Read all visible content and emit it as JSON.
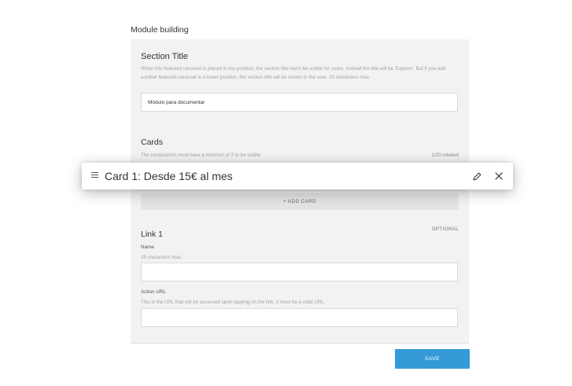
{
  "module": {
    "title": "Module building"
  },
  "section": {
    "title": "Section Title",
    "description": "When this featured carousel is placed in top position, the section title won't be visible for users, instead the title will be 'Explore'. But if you add another featured carousel in a lower position, the section title will be shown to the user. 25 characters max.",
    "value": "Módulo para documentar"
  },
  "cards": {
    "title": "Cards",
    "description": "The composition must have a minimun of 2 to be visible",
    "count": "1/20 created",
    "add_label": "+ ADD CARD",
    "items": [
      {
        "label": "Card 1: Desde 15€ al mes"
      }
    ]
  },
  "link": {
    "title": "Link 1",
    "optional_label": "OPTIONAL",
    "name_label": "Name",
    "name_help": "38 characters max.",
    "name_value": "",
    "url_label": "Action URL",
    "url_help": "This is the URL that will be accessed upon tapping on the link. It must be a valid URL.",
    "url_value": ""
  },
  "actions": {
    "save_label": "SAVE"
  },
  "colors": {
    "accent": "#359bd8",
    "panel": "#f2f2f2"
  }
}
